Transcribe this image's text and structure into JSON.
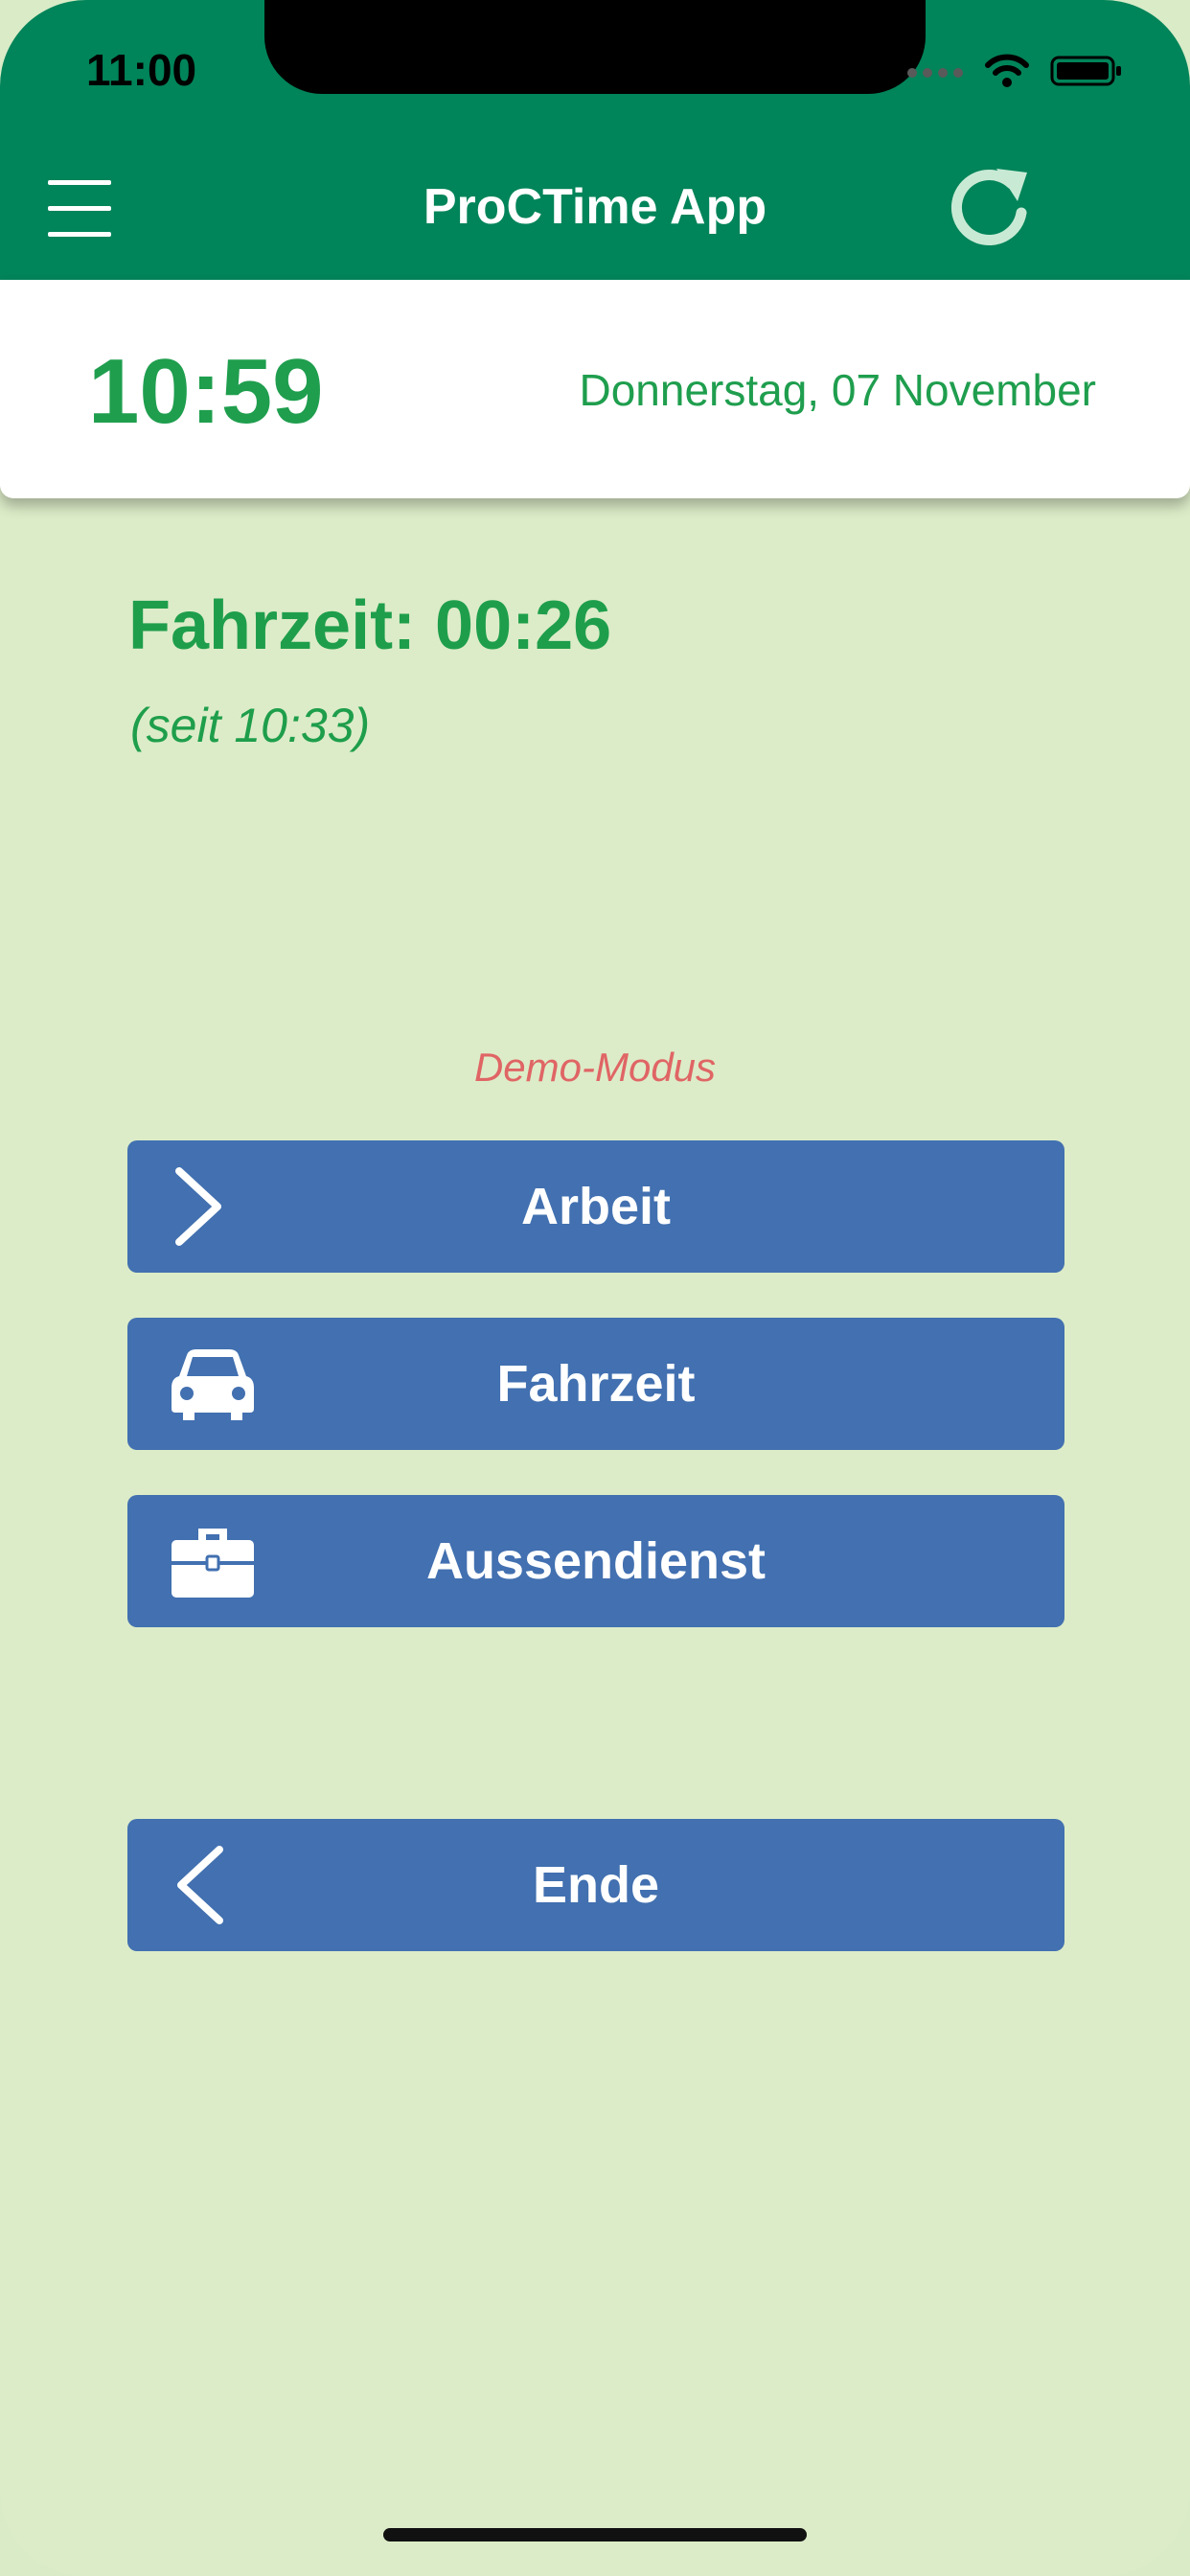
{
  "status_bar": {
    "time": "11:00"
  },
  "nav": {
    "title": "ProCTime App",
    "menu_icon": "hamburger-menu-icon",
    "refresh_icon": "refresh-icon"
  },
  "clock": {
    "time": "10:59",
    "date": "Donnerstag, 07 November"
  },
  "status": {
    "label": "Fahrzeit: 00:26",
    "since": "(seit 10:33)"
  },
  "demo_label": "Demo-Modus",
  "buttons": [
    {
      "label": "Arbeit",
      "icon": "chevron-right-icon"
    },
    {
      "label": "Fahrzeit",
      "icon": "car-icon"
    },
    {
      "label": "Aussendienst",
      "icon": "briefcase-icon"
    },
    {
      "label": "Ende",
      "icon": "chevron-left-icon"
    }
  ],
  "colors": {
    "header_green": "#008459",
    "background_green": "#dcecc8",
    "text_green": "#1e9e4b",
    "button_blue": "#4270b0",
    "demo_red": "#e06565"
  }
}
